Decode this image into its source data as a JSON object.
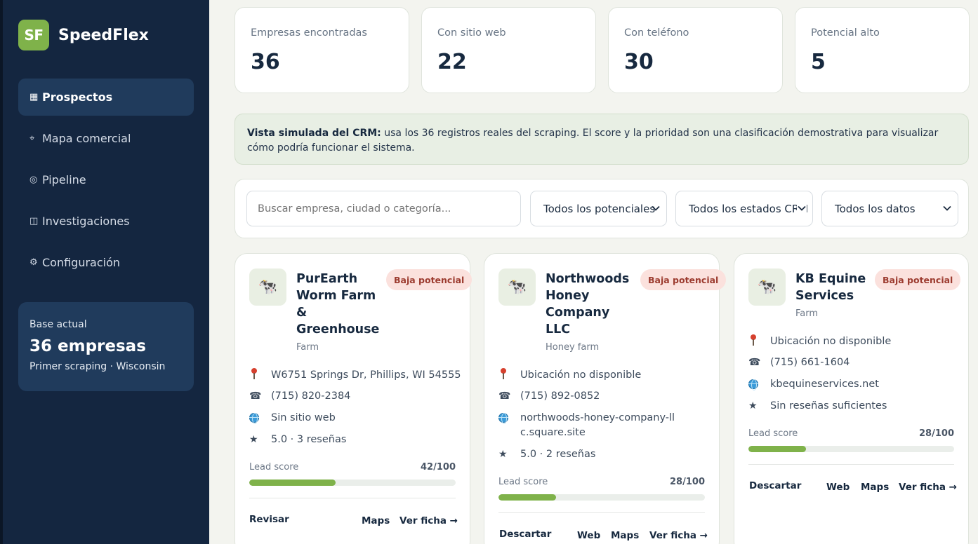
{
  "brand": {
    "logo": "SF",
    "name": "SpeedFlex"
  },
  "nav": [
    {
      "glyph": "▦",
      "label": "Prospectos",
      "active": true
    },
    {
      "glyph": "⌖",
      "label": "Mapa comercial"
    },
    {
      "glyph": "◎",
      "label": "Pipeline"
    },
    {
      "glyph": "◫",
      "label": "Investigaciones"
    },
    {
      "glyph": "⚙",
      "label": "Configuración"
    }
  ],
  "base": {
    "label": "Base actual",
    "value": "36 empresas",
    "sub": "Primer scraping · Wisconsin"
  },
  "stats": [
    {
      "label": "Empresas encontradas",
      "value": "36"
    },
    {
      "label": "Con sitio web",
      "value": "22"
    },
    {
      "label": "Con teléfono",
      "value": "30"
    },
    {
      "label": "Potencial alto",
      "value": "5"
    }
  ],
  "notice": {
    "bold": "Vista simulada del CRM:",
    "text": " usa los 36 registros reales del scraping. El score y la prioridad son una clasificación demostrativa para visualizar cómo podría funcionar el sistema."
  },
  "filters": {
    "search_placeholder": "Buscar empresa, ciudad o categoría...",
    "potential": "Todos los potenciales",
    "status": "Todos los estados CRM",
    "data": "Todos los datos"
  },
  "colors": {
    "accent": "#7fb24a",
    "sidebar": "#142640",
    "badge_bg": "#fbe1dd",
    "badge_text": "#9c3b2f"
  },
  "cards": [
    {
      "avatar_icon": "cow-icon",
      "title": "PurEarth Worm Farm & Greenhouse",
      "category": "Farm",
      "badge": "Baja potencial",
      "address": "W6751 Springs Dr, Phillips, WI 54555",
      "phone": "(715) 820-2384",
      "website": "Sin sitio web",
      "rating": "5.0 · 3 reseñas",
      "score_label": "Lead score",
      "score_text": "42/100",
      "score": 42,
      "actions": {
        "primary": "Revisar",
        "maps": "Maps",
        "detail": "Ver ficha →"
      }
    },
    {
      "avatar_icon": "cow-icon",
      "title": "Northwoods Honey Company LLC",
      "category": "Honey farm",
      "badge": "Baja potencial",
      "address": "Ubicación no disponible",
      "phone": "(715) 892-0852",
      "website": "northwoods-honey-company-llc.square.site",
      "rating": "5.0 · 2 reseñas",
      "score_label": "Lead score",
      "score_text": "28/100",
      "score": 28,
      "actions": {
        "primary": "Descartar",
        "web": "Web",
        "maps": "Maps",
        "detail": "Ver ficha →"
      }
    },
    {
      "avatar_icon": "cow-icon",
      "title": "KB Equine Services",
      "category": "Farm",
      "badge": "Baja potencial",
      "address": "Ubicación no disponible",
      "phone": "(715) 661-1604",
      "website": "kbequineservices.net",
      "rating": "Sin reseñas suficientes",
      "score_label": "Lead score",
      "score_text": "28/100",
      "score": 28,
      "actions": {
        "primary": "Descartar",
        "web": "Web",
        "maps": "Maps",
        "detail": "Ver ficha →"
      }
    }
  ]
}
